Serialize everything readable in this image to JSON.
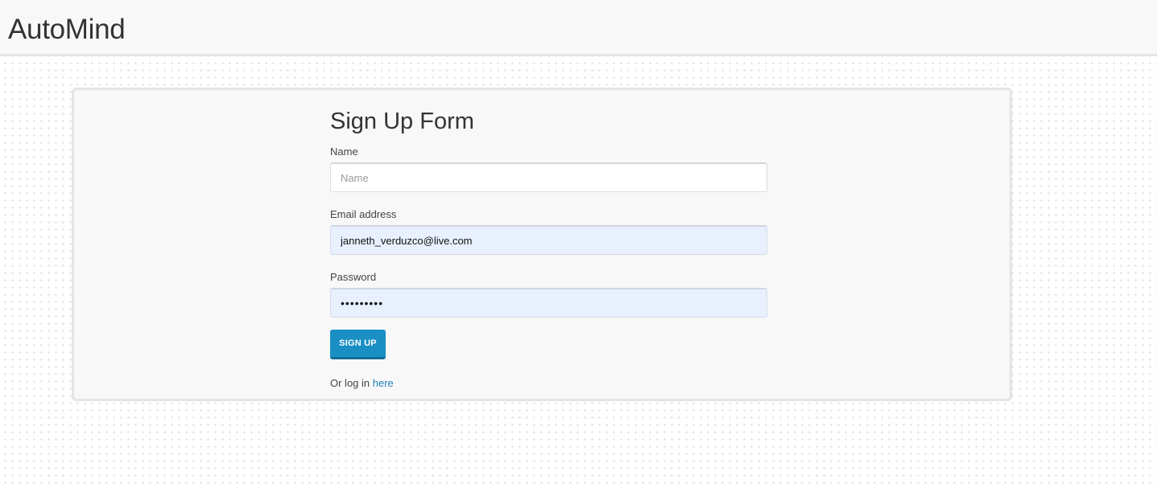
{
  "navbar": {
    "brand": "AutoMind"
  },
  "signup": {
    "title": "Sign Up Form",
    "name_label": "Name",
    "name_value": "",
    "name_placeholder": "Name",
    "email_label": "Email address",
    "email_value": "janneth_verduzco@live.com",
    "password_label": "Password",
    "password_value": "•••••••••",
    "submit_label": "SIGN UP",
    "login_prefix": "Or log in ",
    "login_link": "here"
  },
  "colors": {
    "accent": "#1a8fc4",
    "link": "#1f7fb5",
    "autofill_bg": "#e8f0fe",
    "panel_bg": "#f8f8f8"
  }
}
